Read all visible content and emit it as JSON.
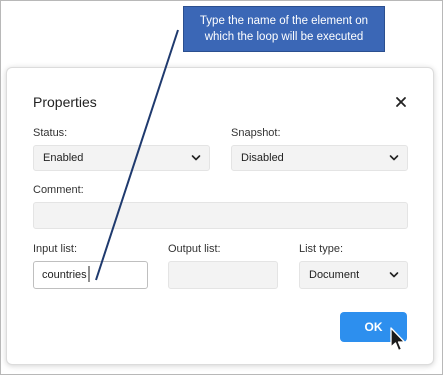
{
  "callout": {
    "line1": "Type the name of the element on",
    "line2": "which the loop will be executed"
  },
  "dialog": {
    "title": "Properties",
    "close_icon": "close-icon",
    "status": {
      "label": "Status:",
      "value": "Enabled"
    },
    "snapshot": {
      "label": "Snapshot:",
      "value": "Disabled"
    },
    "comment": {
      "label": "Comment:",
      "value": ""
    },
    "input_list": {
      "label": "Input list:",
      "value": "countries"
    },
    "output_list": {
      "label": "Output list:",
      "value": ""
    },
    "list_type": {
      "label": "List type:",
      "value": "Document"
    },
    "ok_label": "OK"
  },
  "colors": {
    "accent": "#2d8fee",
    "callout_bg": "#3b67b6",
    "pointer_line": "#1f3a6e"
  }
}
